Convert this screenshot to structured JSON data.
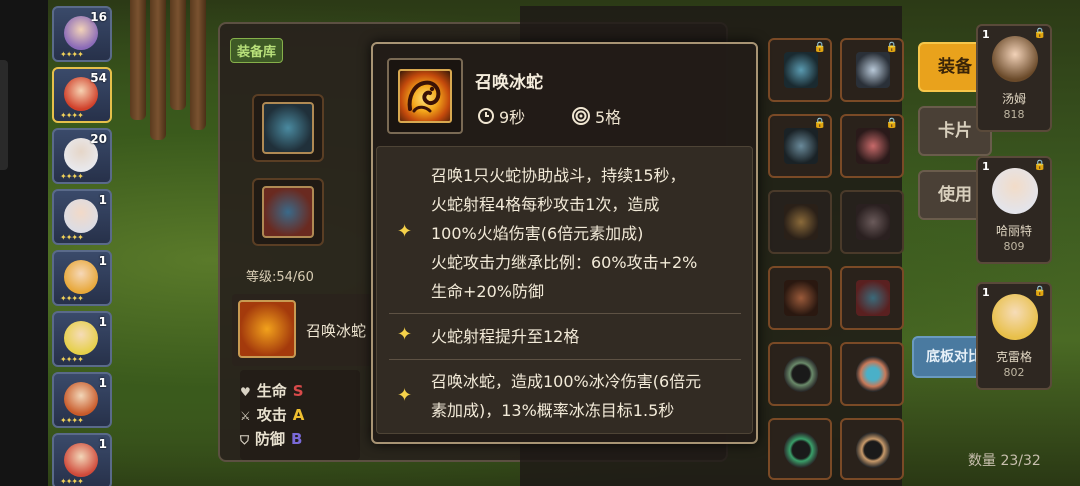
{
  "left_panel": {
    "storage_tag": "装备库",
    "level_text": "等级:54/60",
    "skill_row_name": "召唤冰蛇",
    "stats": [
      {
        "label": "生命",
        "grade": "S"
      },
      {
        "label": "攻击",
        "grade": "A"
      },
      {
        "label": "防御",
        "grade": "B"
      }
    ]
  },
  "hero_list": [
    {
      "num": "16",
      "stars": "✦✦✦✦"
    },
    {
      "num": "54",
      "stars": "✦✦✦✦"
    },
    {
      "num": "20",
      "stars": "✦✦✦✦"
    },
    {
      "num": "1",
      "stars": "✦✦✦✦"
    },
    {
      "num": "1",
      "stars": "✦✦✦✦"
    },
    {
      "num": "1",
      "stars": "✦✦✦✦"
    },
    {
      "num": "1",
      "stars": "✦✦✦✦"
    },
    {
      "num": "1",
      "stars": "✦✦✦✦"
    }
  ],
  "side_buttons": {
    "equip": "装备",
    "card": "卡片",
    "use": "使用",
    "compare": "底板对比"
  },
  "characters": [
    {
      "level": "1",
      "name": "汤姆",
      "score": "818"
    },
    {
      "level": "1",
      "name": "哈丽特",
      "score": "809"
    },
    {
      "level": "1",
      "name": "克雷格",
      "score": "802"
    }
  ],
  "count_text": "数量 23/32",
  "popup": {
    "title": "召唤冰蛇",
    "cooldown": "9秒",
    "range": "5格",
    "effects": [
      {
        "text": "召唤1只火蛇协助战斗，持续15秒，\n火蛇射程4格每秒攻击1次，造成\n100%火焰伤害(6倍元素加成)\n火蛇攻击力继承比例：60%攻击+2%\n生命+20%防御"
      },
      {
        "text": "火蛇射程提升至12格"
      },
      {
        "text": "召唤冰蛇，造成100%冰冷伤害(6倍元\n素加成)，13%概率冰冻目标1.5秒"
      }
    ]
  },
  "icons": {
    "effect_bullet": "✦",
    "cooldown": "clock-icon",
    "range": "target-icon"
  },
  "colors": {
    "accent_gold": "#e9a21c",
    "popup_border": "#a89474",
    "sparkle": "#f6d24a"
  }
}
